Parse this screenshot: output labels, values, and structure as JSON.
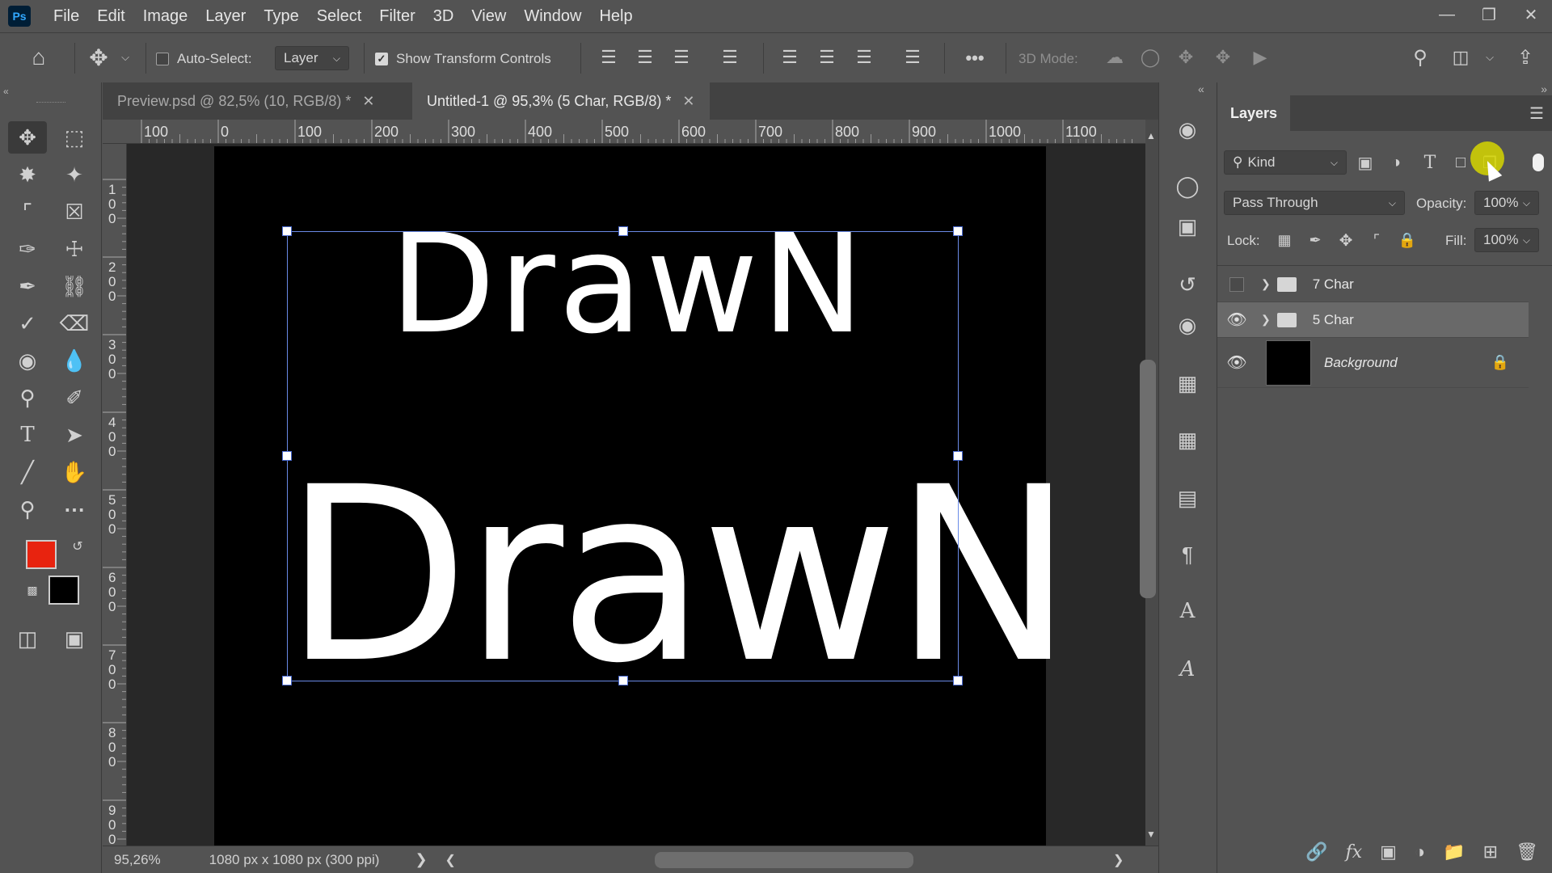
{
  "app": {
    "logo_text": "Ps"
  },
  "menu": [
    "File",
    "Edit",
    "Image",
    "Layer",
    "Type",
    "Select",
    "Filter",
    "3D",
    "View",
    "Window",
    "Help"
  ],
  "window_controls": [
    "minimize-icon",
    "restore-icon",
    "close-icon"
  ],
  "options_bar": {
    "auto_select_label": "Auto-Select:",
    "auto_select_checked": false,
    "auto_select_target": "Layer",
    "show_transform_label": "Show Transform Controls",
    "show_transform_checked": true,
    "more_label": "•••",
    "mode_3d_label": "3D Mode:"
  },
  "documents": {
    "tabs": [
      {
        "label": "Preview.psd @ 82,5% (10, RGB/8) *",
        "active": false
      },
      {
        "label": "Untitled-1 @ 95,3% (5 Char, RGB/8) *",
        "active": true
      }
    ],
    "ruler_top_ticks": [
      "100",
      "0",
      "100",
      "200",
      "300",
      "400",
      "500",
      "600",
      "700",
      "800",
      "900",
      "1000",
      "1100"
    ],
    "ruler_left_ticks": [
      "1\n0\n0",
      "2\n0\n0",
      "3\n0\n0",
      "4\n0\n0",
      "5\n0\n0",
      "6\n0\n0",
      "7\n0\n0",
      "8\n0\n0",
      "9\n0\n0"
    ],
    "canvas_text_top": "DrawN",
    "canvas_text_bottom": "DrawN",
    "status_zoom": "95,26%",
    "status_info": "1080 px x 1080 px (300 ppi)"
  },
  "colors": {
    "foreground": "#e8230f",
    "background": "#000000",
    "ui_bg": "#535353",
    "canvas_bg": "#282828",
    "selection_row": "#696969"
  },
  "layers_panel": {
    "title": "Layers",
    "filter_label": "Kind",
    "blend_mode": "Pass Through",
    "opacity_label": "Opacity:",
    "opacity_value": "100%",
    "lock_label": "Lock:",
    "fill_label": "Fill:",
    "fill_value": "100%",
    "layers": [
      {
        "name": "7 Char",
        "type": "group",
        "visible": false,
        "selected": false
      },
      {
        "name": "5 Char",
        "type": "group",
        "visible": true,
        "selected": true
      },
      {
        "name": "Background",
        "type": "image",
        "visible": true,
        "selected": false,
        "locked": true
      }
    ]
  }
}
